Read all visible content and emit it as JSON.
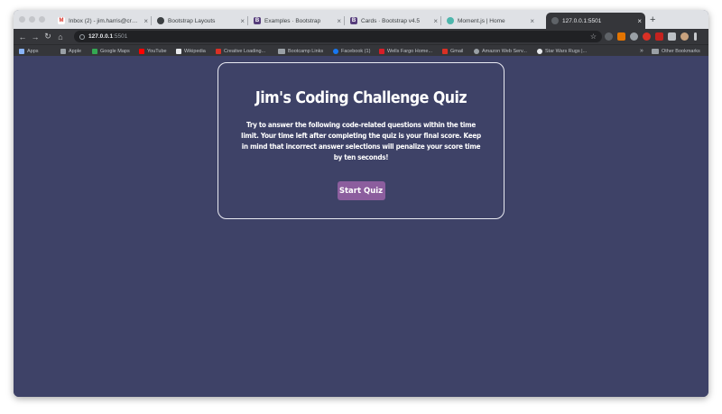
{
  "browser": {
    "tabs": [
      {
        "title": "Inbox (2) - jim.harris@creativ...",
        "icon": "gmail-icon",
        "color": "#d93025"
      },
      {
        "title": "Bootstrap Layouts",
        "icon": "globe-icon",
        "color": "#5f6368"
      },
      {
        "title": "Examples · Bootstrap",
        "icon": "bootstrap-icon",
        "color": "#563d7c"
      },
      {
        "title": "Cards · Bootstrap v4.5",
        "icon": "bootstrap-icon",
        "color": "#563d7c"
      },
      {
        "title": "Moment.js | Home",
        "icon": "moment-icon",
        "color": "#4db6ac"
      },
      {
        "title": "127.0.0.1:5501",
        "icon": "globe-icon",
        "color": "#9aa0a6",
        "active": true
      }
    ],
    "new_tab": "+",
    "address": {
      "host": "127.0.0.1",
      "port": ":5501"
    },
    "bookmarks": [
      {
        "label": "Apps",
        "color": "#8ab4f8"
      },
      {
        "label": "Apple",
        "color": "#9aa0a6"
      },
      {
        "label": "Google Maps",
        "color": "#34a853"
      },
      {
        "label": "YouTube",
        "color": "#ff0000"
      },
      {
        "label": "Wikipedia",
        "color": "#e8eaed"
      },
      {
        "label": "Creative Loading...",
        "color": "#d93025"
      },
      {
        "label": "Bootcamp Links",
        "color": "#9aa0a6"
      },
      {
        "label": "Facebook (1)",
        "color": "#1877f2"
      },
      {
        "label": "Wells Fargo Home...",
        "color": "#d71e28"
      },
      {
        "label": "Gmail",
        "color": "#d93025"
      },
      {
        "label": "Amazon Web Serv...",
        "color": "#9aa0a6"
      },
      {
        "label": "Star Wars Rugs |...",
        "color": "#e8eaed"
      }
    ],
    "more": "»",
    "other_bookmarks": "Other Bookmarks"
  },
  "quiz": {
    "title": "Jim's Coding Challenge Quiz",
    "description": "Try to answer the following code-related questions within the time limit. Your time left after completing the quiz is your final score. Keep in mind that incorrect answer selections will penalize your score time by ten seconds!",
    "start_label": "Start Quiz"
  },
  "colors": {
    "page_background": "#3e4267",
    "button": "#8c5e9e",
    "card_border": "#e9eaf2"
  }
}
